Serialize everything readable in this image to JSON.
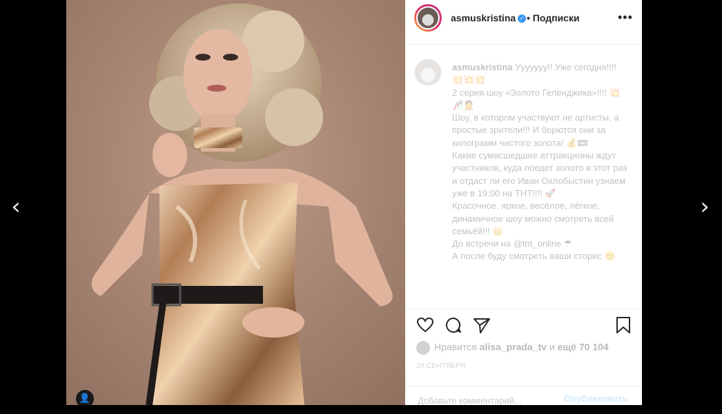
{
  "colors": {
    "accent": "#3897f0",
    "text": "#262626",
    "muted": "#999999"
  },
  "nav": {
    "prev_label": "‹",
    "next_label": "›"
  },
  "header": {
    "username": "asmuskristina",
    "verified_glyph": "✓",
    "separator": "•",
    "follow_label": "Подписки",
    "more_label": "•••"
  },
  "caption": {
    "username": "asmuskristina",
    "text": "Ууууууу!! Уже сегодня!!!! 💥💥💥\n2 серия шоу «Золото Геленджика»!!!! 💥🎢🤦\nШоу, в котором участвуют не артисты, а простые зрители!!! И борются они за килограмм чистого золота! 💰📼\nКакие сумасшедшие аттракционы ждут участников, куда поедет золото в этот раз и отдаст ли его Иван Охлобыстин узнаем уже в 19:00 на ТНТ!!!! 🚀\nКрасочное, яркое, весёлое, лёгкое, динамичное шоу можно смотреть всей семьёй!!! 👑\nДо встречи на @tnt_online ☂\nА после буду смотреть ваши сторис 😊"
  },
  "icons": {
    "like": "heart-icon",
    "comment": "comment-icon",
    "share": "share-icon",
    "save": "bookmark-icon",
    "user_tag": "user-tag-icon"
  },
  "likes": {
    "prefix": "Нравится",
    "user": "alisa_prada_tv",
    "conj": "и",
    "others": "ещё 70 104"
  },
  "date": "20 СЕНТЯБРЯ",
  "comment_box": {
    "placeholder": "Добавьте комментарий...",
    "publish_label": "Опубликовать"
  }
}
